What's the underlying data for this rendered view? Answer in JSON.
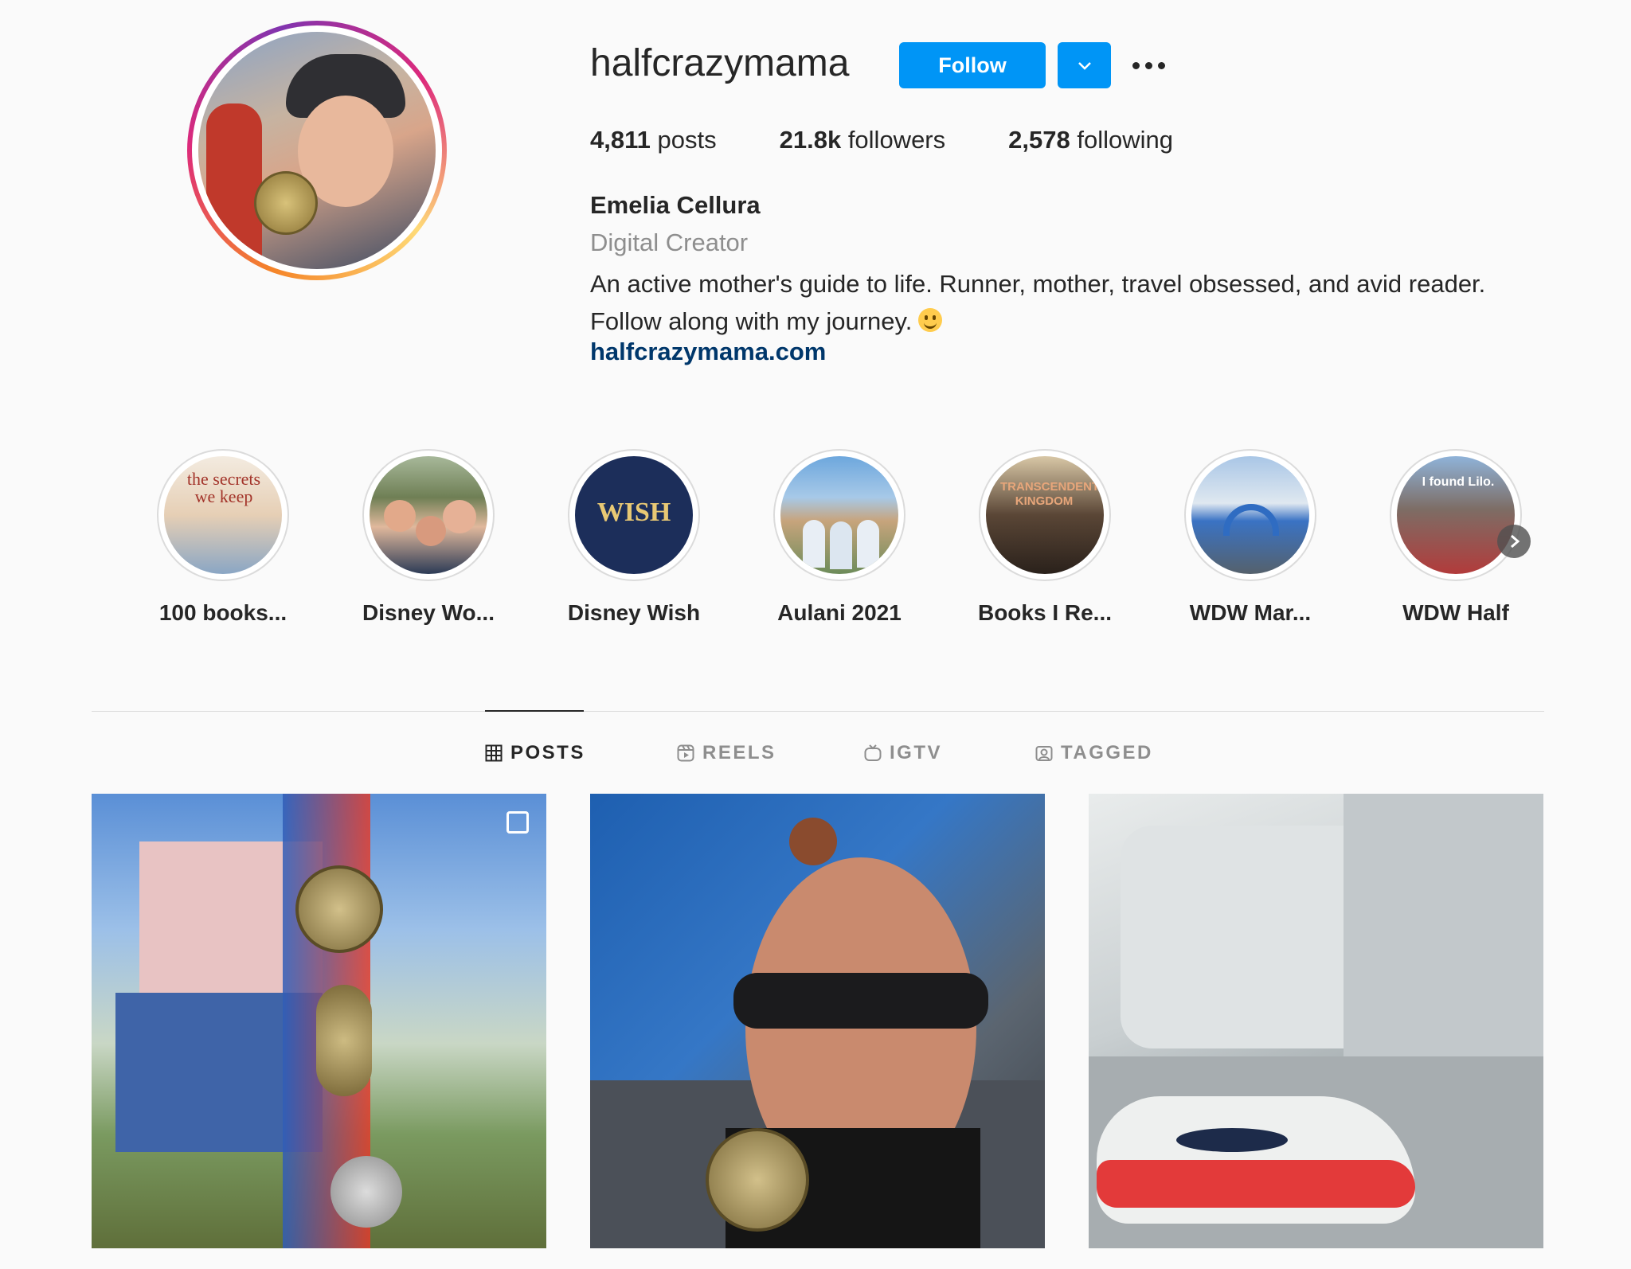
{
  "profile": {
    "username": "halfcrazymama",
    "follow_label": "Follow",
    "stats": {
      "posts_count": "4,811",
      "posts_label": "posts",
      "followers_count": "21.8k",
      "followers_label": "followers",
      "following_count": "2,578",
      "following_label": "following"
    },
    "full_name": "Emelia Cellura",
    "category": "Digital Creator",
    "bio_line1": "An active mother's guide to life. Runner, mother, travel obsessed, and avid reader.",
    "bio_line2": "Follow along with my journey.",
    "website": "halfcrazymama.com"
  },
  "highlights": [
    {
      "label": "100 books...",
      "color": "#c9a27a",
      "text": "the secrets we keep"
    },
    {
      "label": "Disney Wo...",
      "color": "#6b7f9a",
      "text": ""
    },
    {
      "label": "Disney Wish",
      "color": "#1c2e5a",
      "text": "WISH"
    },
    {
      "label": "Aulani 2021",
      "color": "#7fb0d8",
      "text": ""
    },
    {
      "label": "Books I Re...",
      "color": "#4b3b33",
      "text": "TRANSCENDENT KINGDOM"
    },
    {
      "label": "WDW Mar...",
      "color": "#6f8fb3",
      "text": ""
    },
    {
      "label": "WDW Half",
      "color": "#7d6d65",
      "text": "I found Lilo."
    }
  ],
  "tabs": {
    "posts": "POSTS",
    "reels": "REELS",
    "igtv": "IGTV",
    "tagged": "TAGGED"
  },
  "icons": {
    "more": "more-dots-icon",
    "dropdown": "chevron-down-icon",
    "highlights_next": "chevron-right-icon"
  },
  "colors": {
    "accent": "#0095f6",
    "link": "#00376b",
    "muted": "#8e8e8e"
  }
}
